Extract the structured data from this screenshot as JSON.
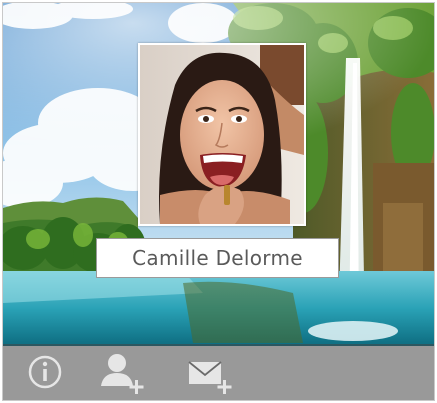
{
  "profile": {
    "name": "Camille Delorme"
  },
  "toolbar": {
    "buttons": [
      {
        "icon": "info-icon"
      },
      {
        "icon": "add-contact-icon"
      },
      {
        "icon": "send-mail-icon"
      }
    ]
  },
  "colors": {
    "toolbar_bg": "#464646",
    "icon_color": "#e6e6e6",
    "name_text": "#5a5a5a"
  }
}
